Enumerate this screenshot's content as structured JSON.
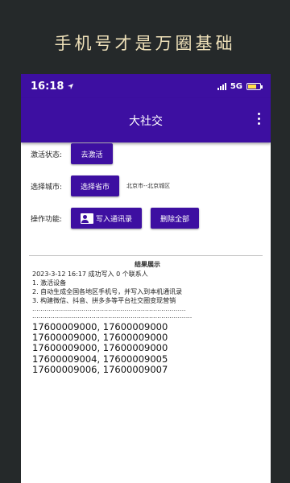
{
  "promo": {
    "title": "手机号才是万圈基础"
  },
  "status_bar": {
    "time": "16:18",
    "network": "5G",
    "battery_color": "#ffe24a"
  },
  "app_bar": {
    "title": "大社交",
    "accent": "#3d0fa1"
  },
  "activation": {
    "label": "激活状态:",
    "button": "去激活"
  },
  "city": {
    "label": "选择城市:",
    "button": "选择省市",
    "value": "北京市--北京城区"
  },
  "actions": {
    "label": "操作功能:",
    "write_button": "写入通讯录",
    "delete_button": "删除全部"
  },
  "results": {
    "title": "结果展示",
    "summary": "2023-3-12 16:17 成功写入 0 个联系人",
    "lines": [
      "1. 激活设备",
      "2. 自动生成全国各地区手机号，并写入到本机通讯录",
      "3. 构建微信、抖音、拼多多等平台社交圈变现营销"
    ],
    "dots": [
      "...........................................................................",
      ".............................................................................."
    ],
    "numbers": [
      "17600009000, 17600009000",
      "17600009000, 17600009000",
      "17600009000, 17600009000",
      "17600009004, 17600009005",
      "17600009006, 17600009007"
    ]
  }
}
